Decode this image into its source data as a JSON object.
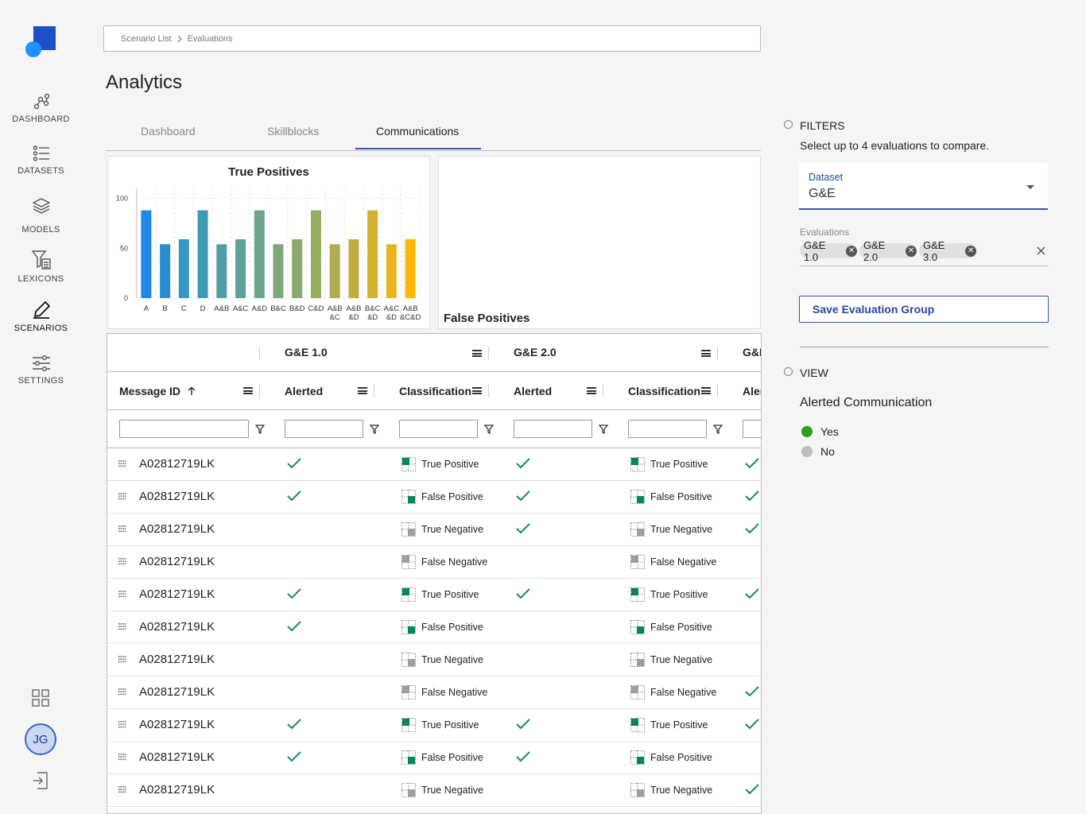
{
  "sidebar": {
    "items": [
      {
        "label": "DASHBOARD",
        "icon": "dashboard-nodes-icon"
      },
      {
        "label": "DATASETS",
        "icon": "list-icon"
      },
      {
        "label": "MODELS",
        "icon": "layers-icon"
      },
      {
        "label": "LEXICONS",
        "icon": "filter-doc-icon"
      },
      {
        "label": "SCENARIOS",
        "icon": "pen-icon"
      },
      {
        "label": "SETTINGS",
        "icon": "sliders-icon"
      }
    ],
    "avatar_initials": "JG"
  },
  "breadcrumb": {
    "items": [
      "Scenario List",
      "Evaluations"
    ]
  },
  "page_title": "Analytics",
  "tabs": [
    {
      "label": "Dashboard",
      "active": false
    },
    {
      "label": "Skillblocks",
      "active": false
    },
    {
      "label": "Communications",
      "active": true
    }
  ],
  "chart_data": [
    {
      "type": "bar",
      "title": "True Positives",
      "categories": [
        "A",
        "B",
        "C",
        "D",
        "A&B",
        "A&C",
        "A&D",
        "B&C",
        "B&D",
        "C&D",
        "A&B &C",
        "A&B &D",
        "B&C &D",
        "A&C &D",
        "A&B &C&D"
      ],
      "values": [
        88,
        54,
        59,
        88,
        54,
        59,
        88,
        54,
        59,
        88,
        54,
        59,
        88,
        54,
        59
      ],
      "ylim": [
        0,
        110
      ],
      "yticks": [
        0,
        50,
        100
      ],
      "bar_colors": [
        "#1e88e5",
        "#2a8ed4",
        "#3797c4",
        "#3f9ab5",
        "#4e9ea8",
        "#5ea398",
        "#6da688",
        "#7ea879",
        "#8aaa6d",
        "#9aac5f",
        "#b0ad4f",
        "#c2ad40",
        "#d4b030",
        "#e8b521",
        "#ffb800"
      ],
      "grid": true
    },
    {
      "type": "bar",
      "title": "False Positives",
      "categories": [],
      "values": []
    }
  ],
  "table": {
    "group_headers": [
      "G&E 1.0",
      "G&E 2.0",
      "G&E"
    ],
    "columns": [
      "Message ID",
      "Alerted",
      "Classification",
      "Alerted",
      "Classification",
      "Aler"
    ],
    "rows": [
      {
        "id": "A02812719LK",
        "a1": true,
        "c1": "True Positive",
        "a2": true,
        "c2": "True Positive",
        "a3": true
      },
      {
        "id": "A02812719LK",
        "a1": true,
        "c1": "False Positive",
        "a2": true,
        "c2": "False Positive",
        "a3": true
      },
      {
        "id": "A02812719LK",
        "a1": false,
        "c1": "True Negative",
        "a2": true,
        "c2": "True Negative",
        "a3": true
      },
      {
        "id": "A02812719LK",
        "a1": false,
        "c1": "False Negative",
        "a2": false,
        "c2": "False Negative",
        "a3": false
      },
      {
        "id": "A02812719LK",
        "a1": true,
        "c1": "True Positive",
        "a2": true,
        "c2": "True Positive",
        "a3": true
      },
      {
        "id": "A02812719LK",
        "a1": true,
        "c1": "False Positive",
        "a2": false,
        "c2": "False Positive",
        "a3": false
      },
      {
        "id": "A02812719LK",
        "a1": false,
        "c1": "True Negative",
        "a2": false,
        "c2": "True Negative",
        "a3": false
      },
      {
        "id": "A02812719LK",
        "a1": false,
        "c1": "False Negative",
        "a2": false,
        "c2": "False Negative",
        "a3": true
      },
      {
        "id": "A02812719LK",
        "a1": true,
        "c1": "True Positive",
        "a2": true,
        "c2": "True Positive",
        "a3": true
      },
      {
        "id": "A02812719LK",
        "a1": true,
        "c1": "False Positive",
        "a2": true,
        "c2": "False Positive",
        "a3": false
      },
      {
        "id": "A02812719LK",
        "a1": false,
        "c1": "True Negative",
        "a2": false,
        "c2": "True Negative",
        "a3": true
      }
    ]
  },
  "filters": {
    "heading": "FILTERS",
    "description": "Select up to 4 evaluations to compare.",
    "dataset_label": "Dataset",
    "dataset_value": "G&E",
    "evaluations_label": "Evaluations",
    "evaluations": [
      "G&E 1.0",
      "G&E 2.0",
      "G&E 3.0"
    ],
    "save_button": "Save Evaluation Group"
  },
  "view": {
    "heading": "VIEW",
    "title": "Alerted Communication",
    "options": [
      {
        "label": "Yes",
        "color": "#2e9e1b"
      },
      {
        "label": "No",
        "color": "#bdbdbd"
      }
    ]
  },
  "colors": {
    "accent": "#3f51b5",
    "check": "#1b8a5a",
    "green_square": "#00875a"
  }
}
